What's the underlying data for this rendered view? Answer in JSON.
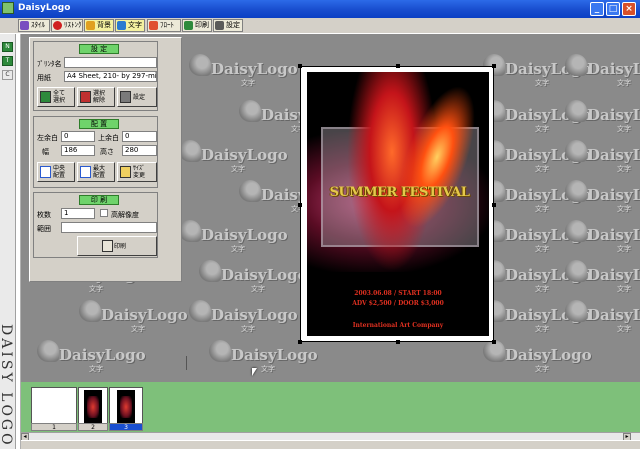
{
  "window": {
    "title": "DaisyLogo"
  },
  "toolbar": {
    "buttons": [
      {
        "label": "ｽﾀｲﾙ",
        "color": "#7a4cc0"
      },
      {
        "label": "ﾘｽﾄﾝｸﾞ",
        "color": "#d02020"
      },
      {
        "label": "背景",
        "color": "#e0a020"
      },
      {
        "label": "文字",
        "color": "#2a7ad0"
      },
      {
        "label": "ﾌﾛｰﾄ",
        "color": "#e05030"
      },
      {
        "label": "印刷",
        "color": "#2e8a3c"
      },
      {
        "label": "設定",
        "color": "#5a5a5a"
      }
    ]
  },
  "left_strip": {
    "tools": [
      "N",
      "T",
      "C"
    ],
    "logo": "DAISY LOGO"
  },
  "watermark": {
    "text": "DaisyLogo",
    "sub": "文字"
  },
  "panel": {
    "settings": {
      "header": "設 定",
      "printer_label": "ﾌﾟﾘﾝﾀ名",
      "printer_value": "",
      "paper_label": "用紙",
      "paper_value": "A4 Sheet, 210- by 297-mil",
      "btn_all_select": "全て\n選択",
      "btn_deselect": "選択\n解除",
      "btn_settings": "設定"
    },
    "layout": {
      "header": "配 置",
      "left_margin_label": "左余白",
      "left_margin_value": "0",
      "top_margin_label": "上余白",
      "top_margin_value": "0",
      "width_label": "幅",
      "width_value": "186",
      "height_label": "高さ",
      "height_value": "280",
      "btn_center": "中央\n配置",
      "btn_max": "最大\n配置",
      "btn_resize": "ｻｲｽﾞ\n変更"
    },
    "print": {
      "header": "印 刷",
      "copies_label": "枚数",
      "copies_value": "1",
      "hires_label": "高解像度",
      "hires_checked": false,
      "range_label": "範囲",
      "range_value": "",
      "btn_print": "印刷"
    }
  },
  "poster": {
    "title": "SUMMER FESTIVAL",
    "line1": "2003.06.08 / START 18:00",
    "line2": "ADV $2,500 / DOOR $3,000",
    "line3": "International Art Company"
  },
  "pages": {
    "items": [
      {
        "number": "1",
        "selected": false
      },
      {
        "number": "2",
        "selected": false
      },
      {
        "number": "3",
        "selected": true
      }
    ]
  },
  "colors": {
    "accent_green": "#6fd36b",
    "page_strip": "#7ec07a",
    "title_bar": "#1a4fd0"
  }
}
